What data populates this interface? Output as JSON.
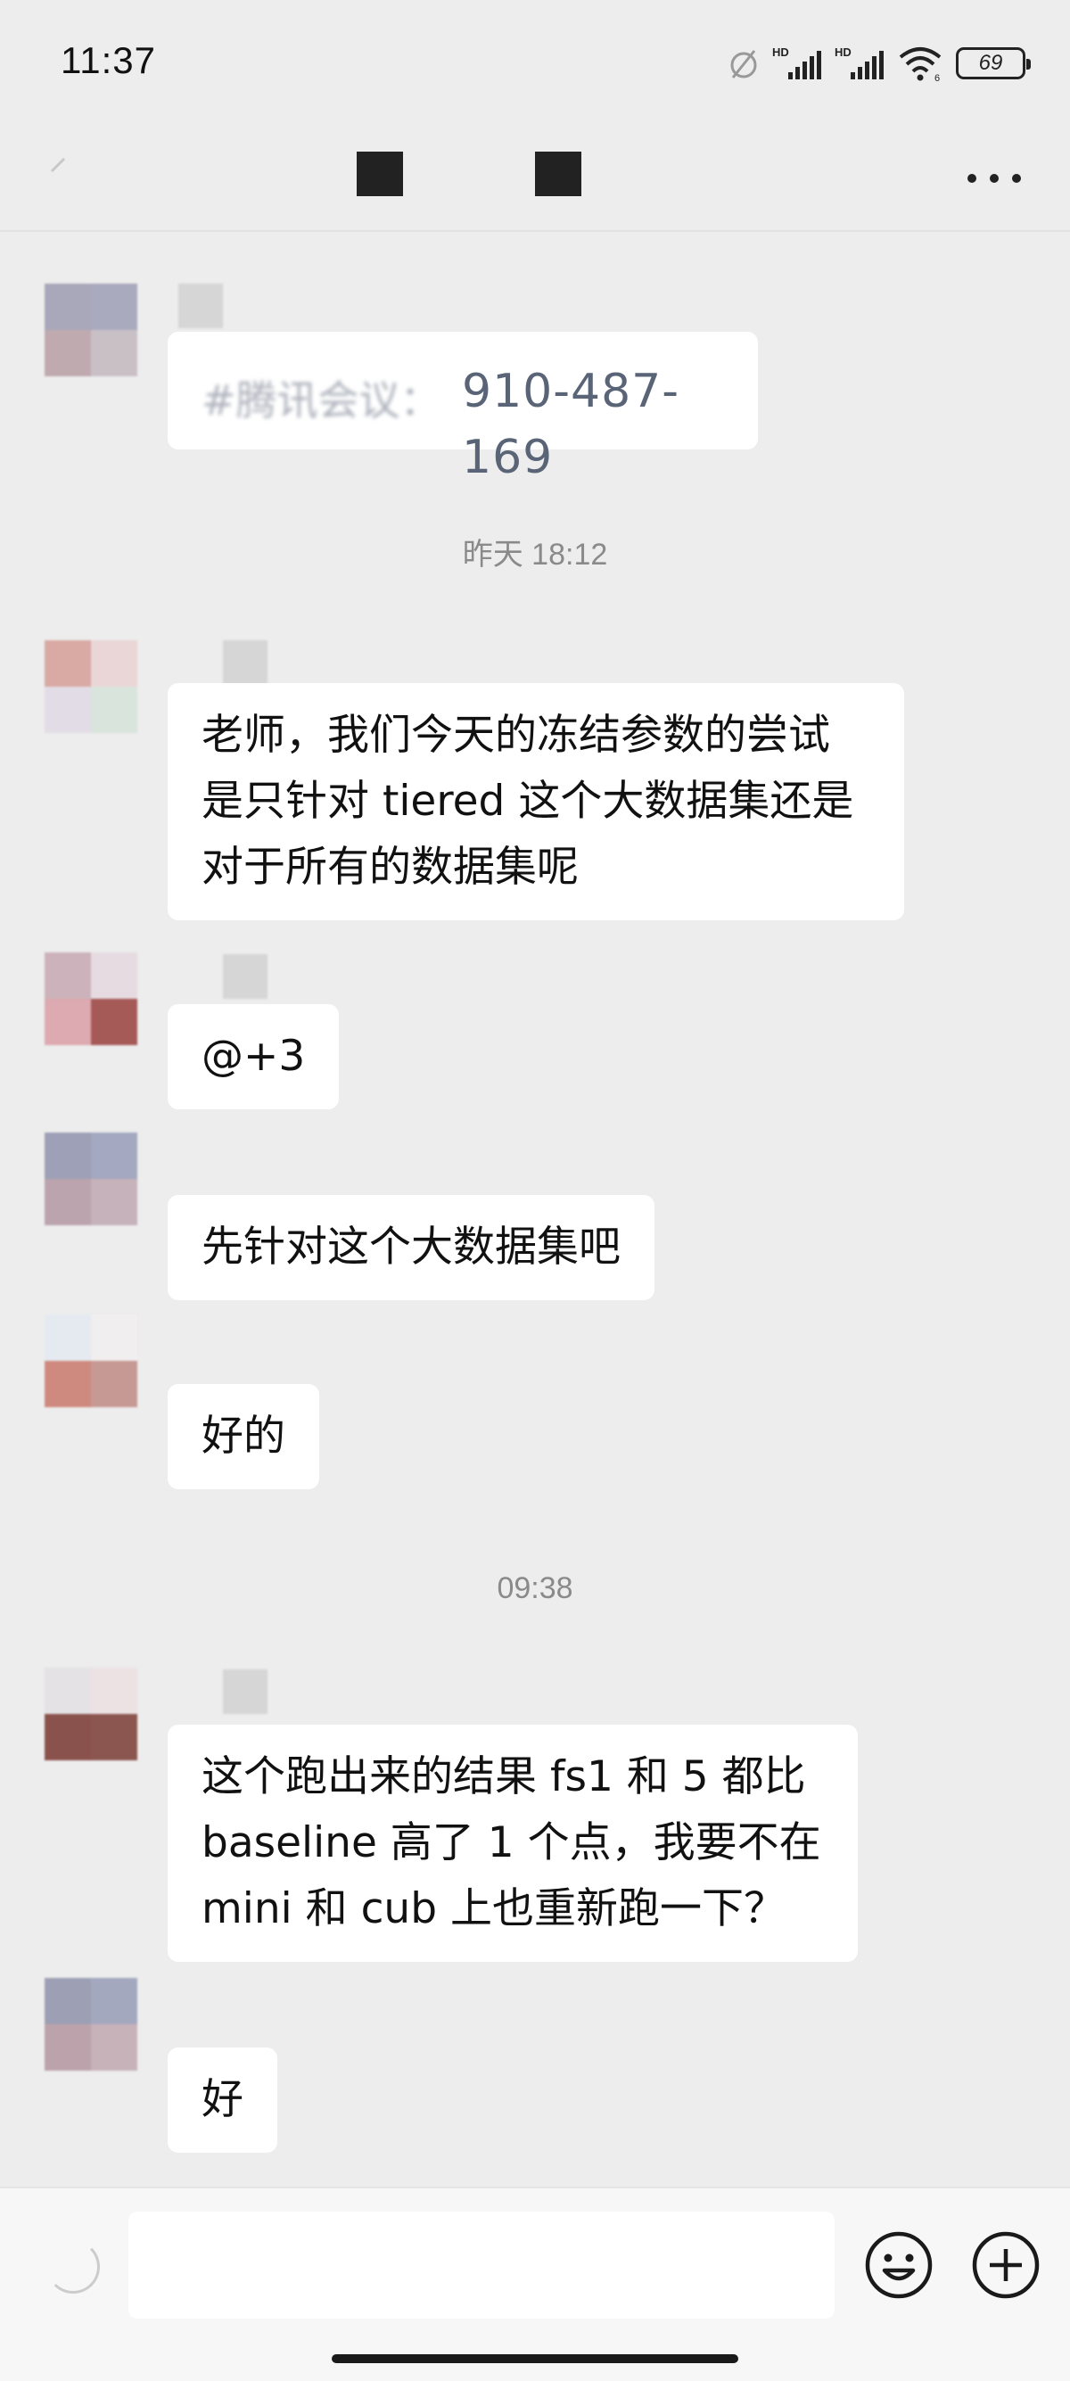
{
  "status_bar": {
    "time": "11:37",
    "battery_level": "69",
    "icons": [
      "alarm-icon",
      "hd-signal-icon",
      "hd-signal-icon",
      "wifi-icon",
      "battery-icon"
    ]
  },
  "header": {
    "title_redacted": true,
    "icons": {
      "back": "back-arrow-icon",
      "more": "more-dots-icon"
    }
  },
  "messages": [
    {
      "type": "text",
      "text": "#腾讯会议：910-487-169",
      "visible_suffix": "910-487-169"
    },
    {
      "type": "timestamp",
      "text": "昨天 18:12"
    },
    {
      "type": "text",
      "lines": [
        "老师，我们今天的冻结参数的尝试",
        "是只针对 tiered 这个大数据集还是",
        "对于所有的数据集呢"
      ]
    },
    {
      "type": "text",
      "text": "@+3"
    },
    {
      "type": "text",
      "text": "先针对这个大数据集吧"
    },
    {
      "type": "text",
      "text": "好的"
    },
    {
      "type": "timestamp",
      "text": "09:38"
    },
    {
      "type": "text",
      "lines": [
        "这个跑出来的结果 fs1 和 5 都比",
        "baseline 高了 1 个点，我要不在",
        "mini 和 cub 上也重新跑一下？"
      ]
    },
    {
      "type": "text",
      "text": "好"
    }
  ],
  "input_bar": {
    "value": "",
    "icons": {
      "voice": "voice-icon",
      "emoji": "emoji-icon",
      "more": "plus-icon"
    }
  },
  "colors": {
    "background": "#ededed",
    "bubble": "#ffffff",
    "timestamp": "#8a8a8a",
    "link_text": "#5a6477"
  }
}
